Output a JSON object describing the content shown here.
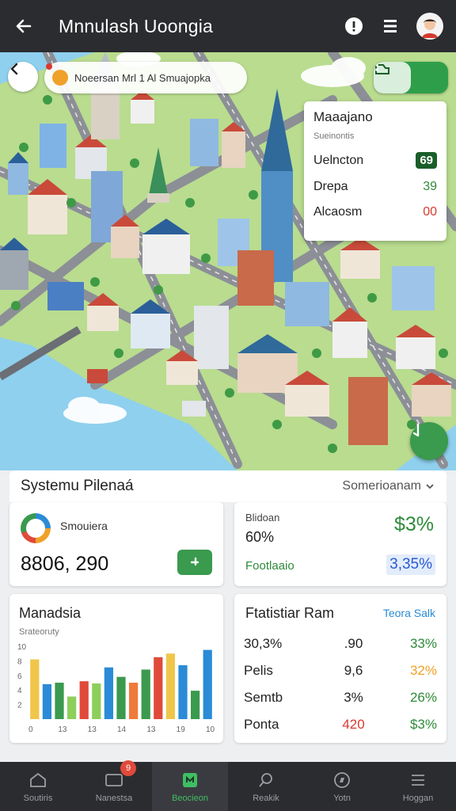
{
  "header": {
    "title": "Mnnulash Uoongia"
  },
  "map": {
    "location_label": "Noeersan Mrl 1 Al Smuajopka",
    "stats_card": {
      "title": "Maaajano",
      "subtitle": "Sueinontis",
      "rows": [
        {
          "label": "Uelncton",
          "value": "69",
          "color": "#ffffff"
        },
        {
          "label": "Drepa",
          "value": "39",
          "color": "#2f8a3a"
        },
        {
          "label": "Alcaosm",
          "value": "00",
          "color": "#d93a2f"
        }
      ]
    }
  },
  "panel": {
    "title": "Systemu Pilenaá",
    "dropdown": "Somerioanam",
    "summary_card": {
      "label": "Smouiera",
      "value": "8806, 290"
    },
    "percent_card": {
      "label1": "Blidoan",
      "label2": "60%",
      "label3": "Footlaaio",
      "value1": "$3%",
      "value2": "3,35%"
    },
    "chart_card": {
      "title": "Manadsia",
      "subtitle": "Srateoruty"
    },
    "stats_table": {
      "title": "Ftatistiar Ram",
      "link": "Teora Salk",
      "rows": [
        {
          "c1": "30,3%",
          "c2": ".90",
          "c3": "33%",
          "c3color": "#2f8a3a",
          "c2color": "#222222"
        },
        {
          "c1": "Pelis",
          "c2": "9,6",
          "c3": "32%",
          "c3color": "#f0a12a",
          "c2color": "#222222"
        },
        {
          "c1": "Semtb",
          "c2": "3%",
          "c3": "26%",
          "c3color": "#2f8a3a",
          "c2color": "#222222"
        },
        {
          "c1": "Ponta",
          "c2": "420",
          "c3": "$3%",
          "c3color": "#2f8a3a",
          "c2color": "#d93a2f"
        }
      ]
    }
  },
  "chart_data": {
    "type": "bar",
    "title": "Manadsia",
    "subtitle": "Srateoruty",
    "ylim": [
      0,
      10
    ],
    "y_ticks": [
      "10",
      "8",
      "6",
      "4",
      "2"
    ],
    "x_ticks": [
      "0",
      "13",
      "13",
      "14",
      "13",
      "19",
      "10"
    ],
    "bars": [
      {
        "value": 8.2,
        "color": "#f0c64a"
      },
      {
        "value": 4.8,
        "color": "#2b8bd6"
      },
      {
        "value": 5.0,
        "color": "#3a9a4d"
      },
      {
        "value": 3.1,
        "color": "#8ccf5a"
      },
      {
        "value": 5.2,
        "color": "#e04a3a"
      },
      {
        "value": 4.9,
        "color": "#8ccf5a"
      },
      {
        "value": 7.1,
        "color": "#2b8bd6"
      },
      {
        "value": 5.8,
        "color": "#3a9a4d"
      },
      {
        "value": 5.0,
        "color": "#f07a3a"
      },
      {
        "value": 6.8,
        "color": "#3a9a4d"
      },
      {
        "value": 8.5,
        "color": "#e04a3a"
      },
      {
        "value": 9.0,
        "color": "#f0c64a"
      },
      {
        "value": 7.4,
        "color": "#2b8bd6"
      },
      {
        "value": 3.9,
        "color": "#3a9a4d"
      },
      {
        "value": 9.5,
        "color": "#2b8bd6"
      }
    ]
  },
  "bottom_nav": {
    "items": [
      {
        "label": "Soutiris",
        "icon": "home-icon"
      },
      {
        "label": "Nanestsa",
        "icon": "messages-icon",
        "badge": "9"
      },
      {
        "label": "Beocieon",
        "icon": "map-icon"
      },
      {
        "label": "Reakik",
        "icon": "search-icon"
      },
      {
        "label": "Yotn",
        "icon": "compass-icon"
      },
      {
        "label": "Hoggan",
        "icon": "menu-icon"
      }
    ]
  }
}
